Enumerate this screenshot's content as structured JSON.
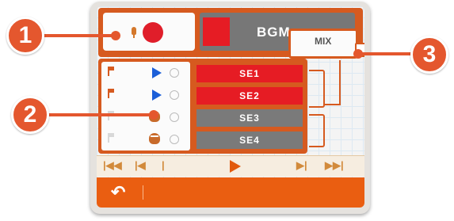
{
  "colors": {
    "frame_orange": "#d65a1f",
    "active_red": "#e61c24",
    "inactive_gray": "#7a7a7a",
    "callout_orange": "#e4572e",
    "play_blue": "#1c5fd8"
  },
  "record": {
    "record_icon": "record-icon",
    "mic_icon": "mic-icon"
  },
  "bgm": {
    "label": "BGM"
  },
  "mix": {
    "label": "MIX"
  },
  "tracks": [
    {
      "label": "SE1",
      "state": "active",
      "icon": "play-icon"
    },
    {
      "label": "SE2",
      "state": "active",
      "icon": "play-icon"
    },
    {
      "label": "SE3",
      "state": "inactive",
      "icon": "drum-icon"
    },
    {
      "label": "SE4",
      "state": "inactive",
      "icon": "drum-icon"
    }
  ],
  "transport": {
    "first": "|◀◀",
    "prev": "|◀",
    "tick": "|",
    "next": "▶|",
    "last": "▶▶|"
  },
  "bottom_bar": {
    "back_icon": "↶"
  },
  "callouts": [
    {
      "number": "1"
    },
    {
      "number": "2"
    },
    {
      "number": "3"
    }
  ]
}
